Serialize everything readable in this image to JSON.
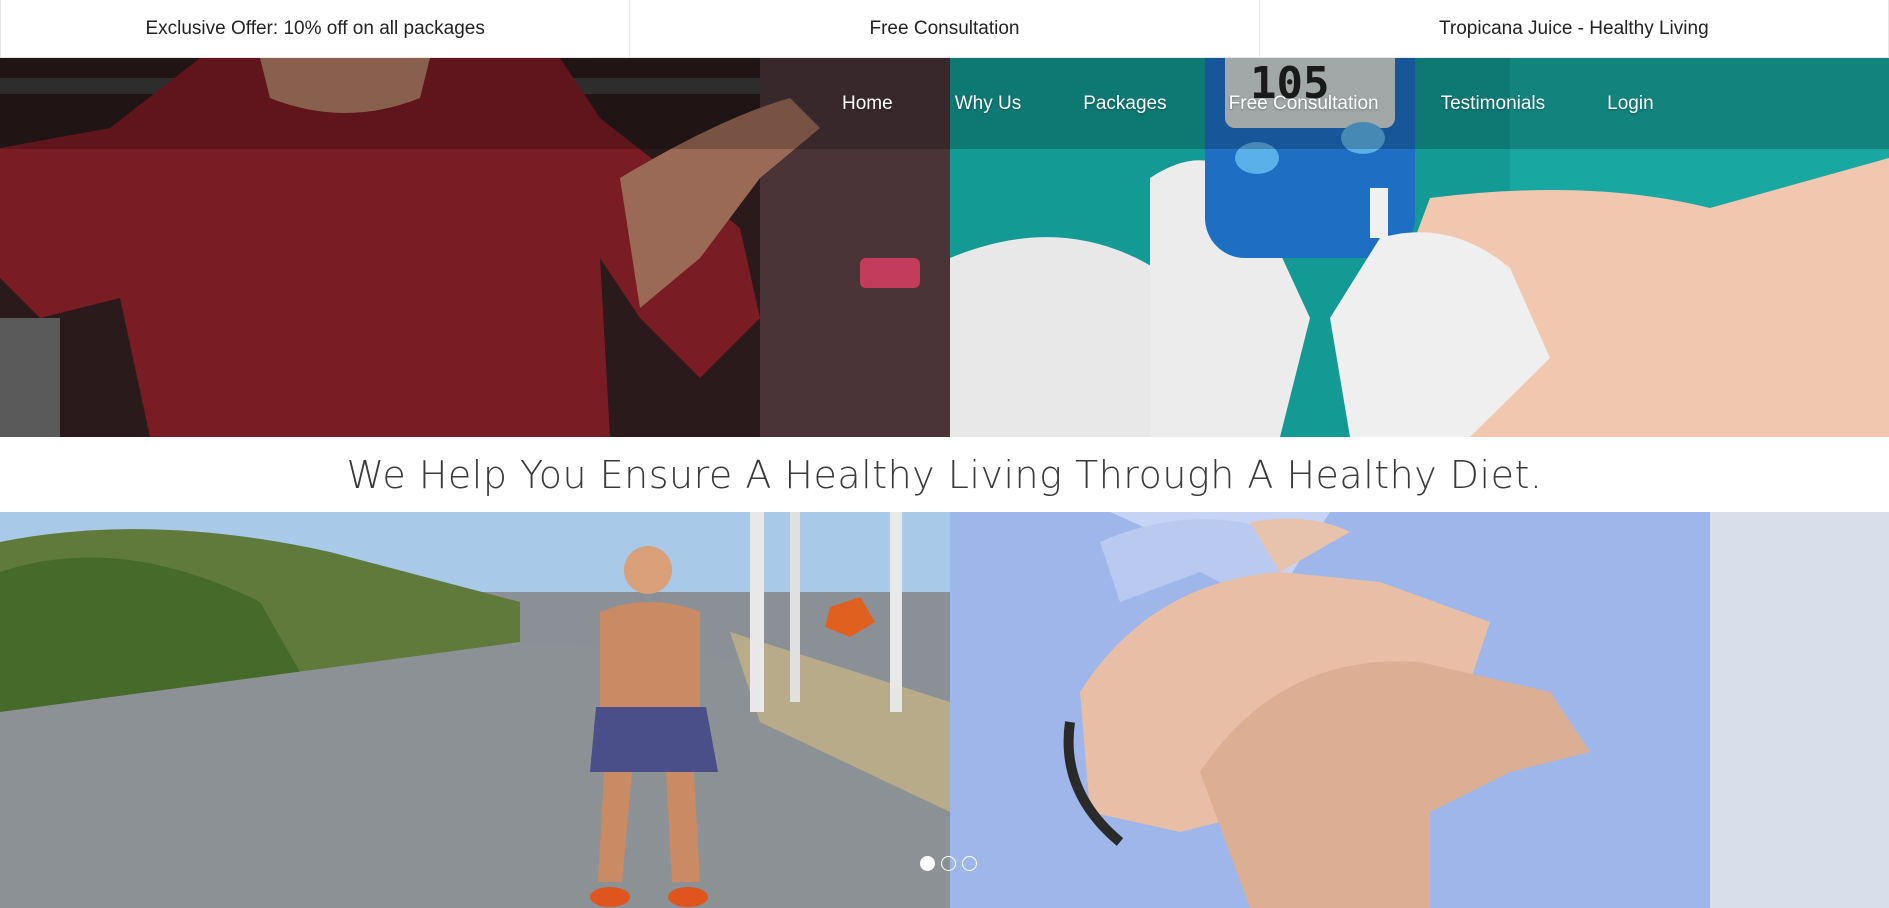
{
  "topbar": {
    "items": [
      {
        "label": "Exclusive Offer: 10% off on all packages"
      },
      {
        "label": "Free Consultation"
      },
      {
        "label": "Tropicana Juice - Healthy Living"
      }
    ]
  },
  "nav": {
    "items": [
      {
        "label": "Home"
      },
      {
        "label": "Why Us"
      },
      {
        "label": "Packages"
      },
      {
        "label": "Free Consultation"
      },
      {
        "label": "Testimonials"
      },
      {
        "label": "Login"
      }
    ]
  },
  "hero": {
    "tagline": "We Help You Ensure A Healthy Living Through A Healthy Diet.",
    "glucose_reading": "105"
  },
  "carousel": {
    "slide_count": 3,
    "active_index": 0
  },
  "colors": {
    "nav_text": "#ffffff",
    "tagline_text": "#3a3a3a",
    "topbar_text": "#222222"
  }
}
